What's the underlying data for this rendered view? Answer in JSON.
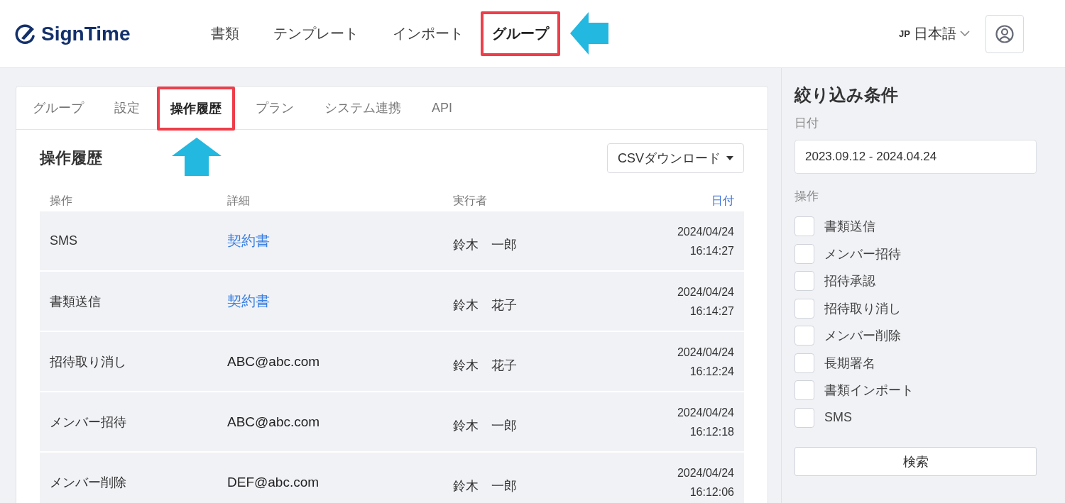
{
  "header": {
    "logo": "SignTime",
    "nav": [
      {
        "label": "書類",
        "selected": false,
        "highlighted": false
      },
      {
        "label": "テンプレート",
        "selected": false,
        "highlighted": false
      },
      {
        "label": "インポート",
        "selected": false,
        "highlighted": false
      },
      {
        "label": "グループ",
        "selected": true,
        "highlighted": true
      }
    ],
    "language": {
      "code": "JP",
      "label": "日本語"
    }
  },
  "tabs": [
    {
      "label": "グループ",
      "selected": false,
      "highlighted": false
    },
    {
      "label": "設定",
      "selected": false,
      "highlighted": false
    },
    {
      "label": "操作履歴",
      "selected": true,
      "highlighted": true
    },
    {
      "label": "プラン",
      "selected": false,
      "highlighted": false
    },
    {
      "label": "システム連携",
      "selected": false,
      "highlighted": false
    },
    {
      "label": "API",
      "selected": false,
      "highlighted": false
    }
  ],
  "history": {
    "title": "操作履歴",
    "csv_button": "CSVダウンロード",
    "columns": [
      {
        "label": "操作",
        "sorted": false
      },
      {
        "label": "詳細",
        "sorted": false
      },
      {
        "label": "実行者",
        "sorted": false
      },
      {
        "label": "日付",
        "sorted": true
      }
    ],
    "rows": [
      {
        "operation": "SMS",
        "detail": {
          "kind": "document",
          "text": "契約書"
        },
        "user": "鈴木　一郎",
        "date": "2024/04/24",
        "time": "16:14:27"
      },
      {
        "operation": "書類送信",
        "detail": {
          "kind": "document",
          "text": "契約書"
        },
        "user": "鈴木　花子",
        "date": "2024/04/24",
        "time": "16:14:27"
      },
      {
        "operation": "招待取り消し",
        "detail": {
          "kind": "email",
          "text": "ABC@abc.com"
        },
        "user": "鈴木　花子",
        "date": "2024/04/24",
        "time": "16:12:24"
      },
      {
        "operation": "メンバー招待",
        "detail": {
          "kind": "email",
          "text": "ABC@abc.com"
        },
        "user": "鈴木　一郎",
        "date": "2024/04/24",
        "time": "16:12:18"
      },
      {
        "operation": "メンバー削除",
        "detail": {
          "kind": "email",
          "text": "DEF@abc.com"
        },
        "user": "鈴木　一郎",
        "date": "2024/04/24",
        "time": "16:12:06"
      }
    ]
  },
  "filters": {
    "title": "絞り込み条件",
    "date_label": "日付",
    "date_value": "2023.09.12 - 2024.04.24",
    "operation_label": "操作",
    "operations": [
      {
        "label": "書類送信",
        "checked": false
      },
      {
        "label": "メンバー招待",
        "checked": false
      },
      {
        "label": "招待承認",
        "checked": false
      },
      {
        "label": "招待取り消し",
        "checked": false
      },
      {
        "label": "メンバー削除",
        "checked": false
      },
      {
        "label": "長期署名",
        "checked": false
      },
      {
        "label": "書類インポート",
        "checked": false
      },
      {
        "label": "SMS",
        "checked": false
      }
    ],
    "search_button": "検索"
  }
}
